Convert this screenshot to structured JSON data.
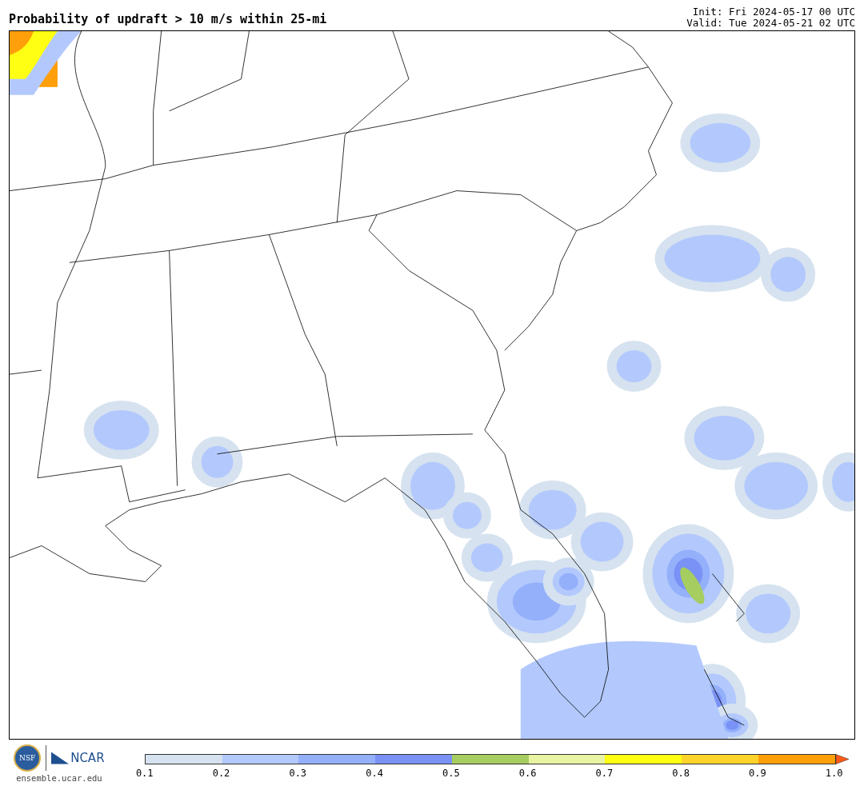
{
  "title": "Probability of updraft > 10 m/s within 25-mi",
  "init": "Init: Fri 2024-05-17 00 UTC",
  "valid": "Valid: Tue 2024-05-21 02 UTC",
  "logos": {
    "nsf": "NSF",
    "ncar": "NCAR",
    "site": "ensemble.ucar.edu"
  },
  "colorbar": {
    "bins": [
      {
        "color": "#d6e2ef"
      },
      {
        "color": "#b3c9fd"
      },
      {
        "color": "#94b0fb"
      },
      {
        "color": "#7a92f5"
      },
      {
        "color": "#a6cd5f"
      },
      {
        "color": "#e9f4a2"
      },
      {
        "color": "#ffff14"
      },
      {
        "color": "#ffd42a"
      },
      {
        "color": "#ff9f0a"
      }
    ],
    "extend": {
      "color": "#ff5a14"
    },
    "ticks": [
      "0.1",
      "0.2",
      "0.3",
      "0.4",
      "0.5",
      "0.6",
      "0.7",
      "0.8",
      "0.9",
      "1.0"
    ]
  }
}
